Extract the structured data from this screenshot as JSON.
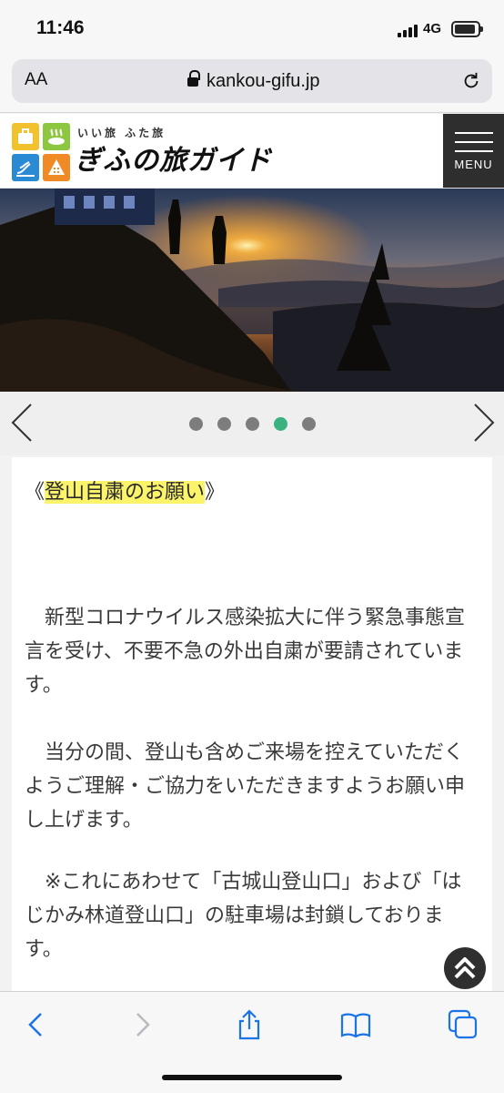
{
  "status_bar": {
    "time": "11:46",
    "network": "4G"
  },
  "browser": {
    "text_size_label": "AA",
    "url": "kankou-gifu.jp"
  },
  "site": {
    "logo_tagline": "いい旅 ふた旅",
    "logo_title": "ぎふの旅ガイド",
    "menu_label": "MENU"
  },
  "carousel": {
    "slide_count": 5,
    "active_index": 3
  },
  "notice": {
    "bracket_open": "《",
    "title": "登山自粛のお願い",
    "bracket_close": "》",
    "paragraphs": [
      "新型コロナウイルス感染拡大に伴う緊急事態宣言を受け、不要不急の外出自粛が要請されています。",
      "当分の間、登山も含めご来場を控えていただくようご理解・ご協力をいただきますようお願い申し上げます。",
      "※これにあわせて「古城山登山口」および「はじかみ林道登山口」の駐車場は封鎖しております。"
    ]
  },
  "colors": {
    "accent_dot": "#3bb27f",
    "highlight": "#fbf36a",
    "menu_bg": "#2e2e2e",
    "ios_blue": "#1a73e8"
  },
  "icons": [
    "lock-icon",
    "reload-icon",
    "menu-icon",
    "chevron-left-icon",
    "chevron-right-icon",
    "scroll-top-icon",
    "back-icon",
    "forward-icon",
    "share-icon",
    "bookmarks-icon",
    "tabs-icon"
  ]
}
